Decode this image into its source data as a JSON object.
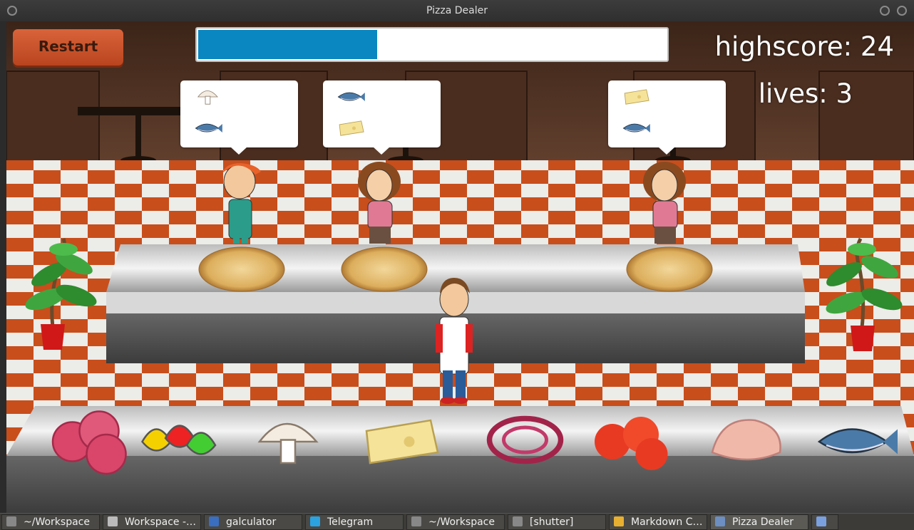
{
  "window": {
    "title": "Pizza Dealer"
  },
  "hud": {
    "restart_label": "Restart",
    "timer_fraction": 0.38,
    "highscore_text": "highscore: 24",
    "lives_text": "lives: 3"
  },
  "customers": [
    {
      "type": "boy",
      "order": [
        "mushroom",
        "tuna"
      ]
    },
    {
      "type": "woman",
      "order": [
        "tuna",
        "cheese"
      ]
    },
    {
      "type": "woman",
      "order": [
        "cheese",
        "tuna"
      ]
    }
  ],
  "pizzas": [
    "plain-pizza",
    "plain-pizza",
    "plain-pizza"
  ],
  "ingredients": [
    "salami",
    "peppers",
    "mushroom",
    "cheese",
    "onion",
    "tomato",
    "ham",
    "tuna"
  ],
  "taskbar": [
    {
      "label": "~/Workspace",
      "icon": "terminal-icon"
    },
    {
      "label": "Workspace -…",
      "icon": "editor-icon"
    },
    {
      "label": "galculator",
      "icon": "calculator-icon"
    },
    {
      "label": "Telegram",
      "icon": "telegram-icon"
    },
    {
      "label": "~/Workspace",
      "icon": "terminal-icon"
    },
    {
      "label": "[shutter]",
      "icon": "terminal-icon"
    },
    {
      "label": "Markdown C…",
      "icon": "chrome-icon"
    },
    {
      "label": "Pizza Dealer",
      "icon": "window-icon",
      "active": true
    },
    {
      "label": "",
      "icon": "show-desktop-icon"
    }
  ],
  "colors": {
    "accent": "#0a87c0",
    "restart": "#c8522b",
    "tile_orange": "#c84e1c"
  }
}
